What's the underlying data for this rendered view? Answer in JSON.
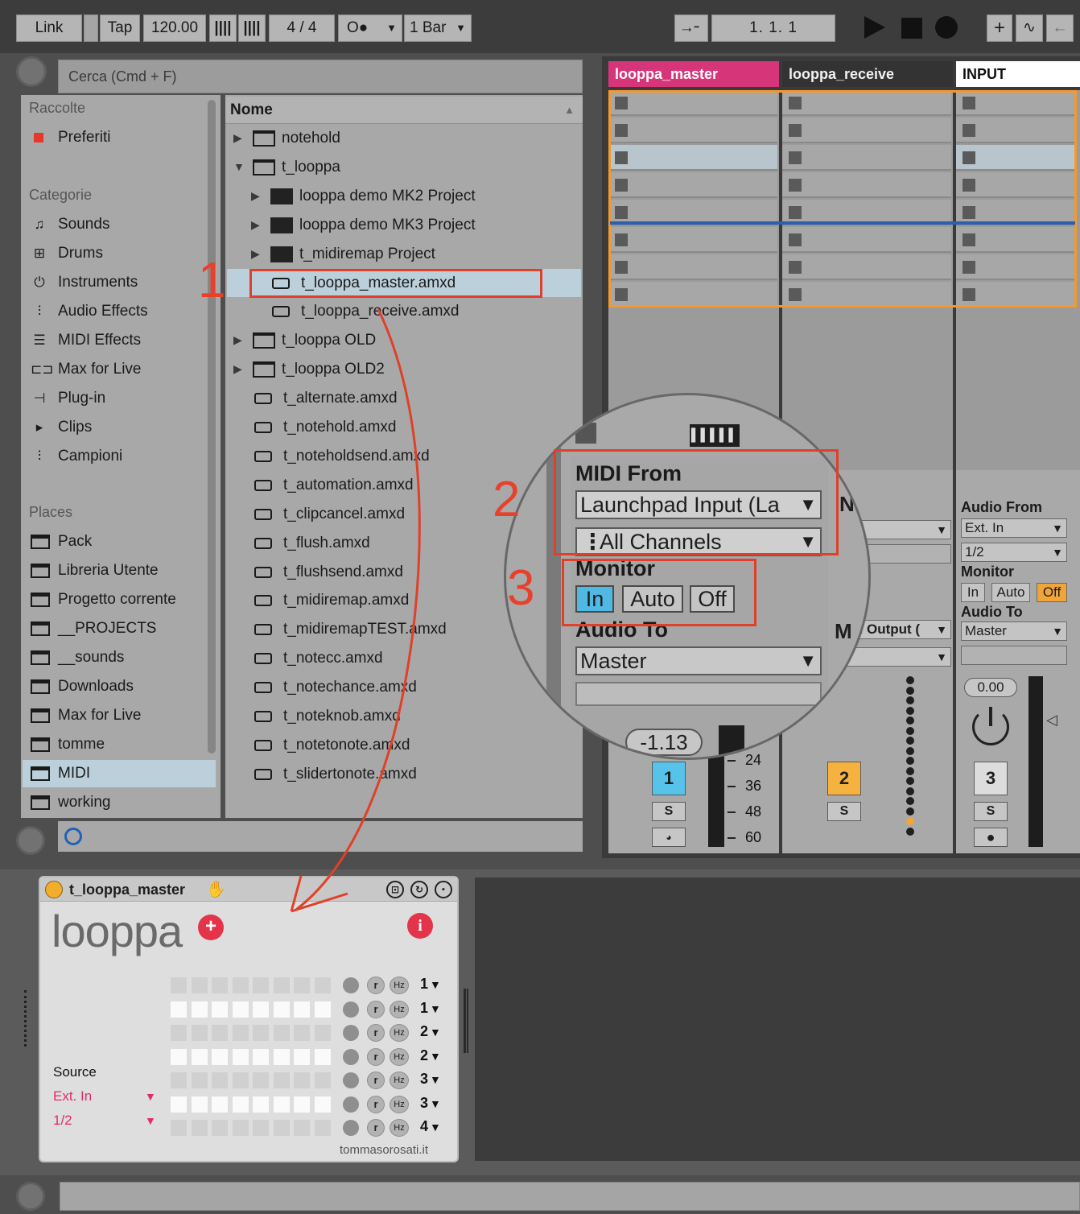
{
  "transport": {
    "link": "Link",
    "tap": "Tap",
    "tempo": "120.00",
    "nudge_down": "||||",
    "nudge_up": "||||",
    "signature": "4  /  4",
    "metronome": "O●",
    "quantize": "1 Bar",
    "position": "1.   1.   1"
  },
  "browser": {
    "search_placeholder": "Cerca (Cmd + F)",
    "collections_header": "Raccolte",
    "favorites": "Preferiti",
    "categories_header": "Categorie",
    "categories": [
      "Sounds",
      "Drums",
      "Instruments",
      "Audio Effects",
      "MIDI Effects",
      "Max for Live",
      "Plug-in",
      "Clips",
      "Campioni"
    ],
    "places_header": "Places",
    "places": [
      "Pack",
      "Libreria Utente",
      "Progetto corrente",
      "__PROJECTS",
      "__sounds",
      "Downloads",
      "Max for Live",
      "tomme",
      "MIDI",
      "working"
    ],
    "selected_place": "MIDI",
    "column_header": "Nome",
    "files": [
      {
        "name": "notehold",
        "type": "folder",
        "expanded": false,
        "indent": 0
      },
      {
        "name": "t_looppa",
        "type": "folder",
        "expanded": true,
        "indent": 0
      },
      {
        "name": "looppa demo MK2 Project",
        "type": "project",
        "indent": 1
      },
      {
        "name": "looppa demo MK3 Project",
        "type": "project",
        "indent": 1
      },
      {
        "name": "t_midiremap Project",
        "type": "project",
        "indent": 1
      },
      {
        "name": "t_looppa_master.amxd",
        "type": "device",
        "indent": 1,
        "selected": true
      },
      {
        "name": "t_looppa_receive.amxd",
        "type": "device",
        "indent": 1
      },
      {
        "name": "t_looppa OLD",
        "type": "folder",
        "expanded": false,
        "indent": 0
      },
      {
        "name": "t_looppa OLD2",
        "type": "folder",
        "expanded": false,
        "indent": 0
      },
      {
        "name": "t_alternate.amxd",
        "type": "device",
        "indent": 0
      },
      {
        "name": "t_notehold.amxd",
        "type": "device",
        "indent": 0
      },
      {
        "name": "t_noteholdsend.amxd",
        "type": "device",
        "indent": 0
      },
      {
        "name": "t_automation.amxd",
        "type": "device",
        "indent": 0
      },
      {
        "name": "t_clipcancel.amxd",
        "type": "device",
        "indent": 0
      },
      {
        "name": "t_flush.amxd",
        "type": "device",
        "indent": 0
      },
      {
        "name": "t_flushsend.amxd",
        "type": "device",
        "indent": 0
      },
      {
        "name": "t_midiremap.amxd",
        "type": "device",
        "indent": 0
      },
      {
        "name": "t_midiremapTEST.amxd",
        "type": "device",
        "indent": 0
      },
      {
        "name": "t_notecc.amxd",
        "type": "device",
        "indent": 0
      },
      {
        "name": "t_notechance.amxd",
        "type": "device",
        "indent": 0
      },
      {
        "name": "t_noteknob.amxd",
        "type": "device",
        "indent": 0
      },
      {
        "name": "t_notetonote.amxd",
        "type": "device",
        "indent": 0
      },
      {
        "name": "t_slidertonote.amxd",
        "type": "device",
        "indent": 0
      }
    ]
  },
  "session": {
    "tracks": [
      {
        "name": "looppa_master",
        "color": "#d6357a"
      },
      {
        "name": "looppa_receive",
        "color": "#3a3a3a"
      },
      {
        "name": "INPUT",
        "color": "#ffffff"
      }
    ],
    "track2": {
      "mid_output": "Mid Output (",
      "number": "2",
      "solo": "S"
    },
    "track3": {
      "audio_from_label": "Audio From",
      "audio_from": "Ext. In",
      "channel": "1/2",
      "monitor_label": "Monitor",
      "monitor_in": "In",
      "monitor_auto": "Auto",
      "monitor_off": "Off",
      "audio_to_label": "Audio To",
      "audio_to": "Master",
      "volume": "0.00",
      "number": "3",
      "solo": "S"
    },
    "track1": {
      "volume": "-1.13",
      "number": "1",
      "solo": "S"
    },
    "meter_scale": [
      "24",
      "36",
      "48",
      "60"
    ]
  },
  "magnifier": {
    "midi_from_label": "MIDI From",
    "midi_from": "Launchpad Input (La",
    "channels": "All Channels",
    "monitor_label": "Monitor",
    "monitor_in": "In",
    "monitor_auto": "Auto",
    "monitor_off": "Off",
    "audio_to_label": "Audio To",
    "audio_to": "Master",
    "volume": "-1.13"
  },
  "annotations": [
    "1",
    "2",
    "3"
  ],
  "device": {
    "title": "t_looppa_master",
    "logo": "looppa",
    "source_label": "Source",
    "source_input": "Ext. In",
    "source_channel": "1/2",
    "credit": "tommasorosati.it",
    "rows": [
      {
        "lit": false,
        "num": "1"
      },
      {
        "lit": true,
        "num": "1"
      },
      {
        "lit": false,
        "num": "2"
      },
      {
        "lit": true,
        "num": "2"
      },
      {
        "lit": false,
        "num": "3"
      },
      {
        "lit": true,
        "num": "3"
      },
      {
        "lit": false,
        "num": "4"
      }
    ],
    "r_label": "r",
    "hz_label": "Hz"
  },
  "colors": {
    "accent_red": "#e0402a",
    "pink": "#d6357a",
    "orange": "#f0a43a",
    "selection_blue": "#bcd0dc",
    "monitor_in_blue": "#4fb9e3"
  }
}
